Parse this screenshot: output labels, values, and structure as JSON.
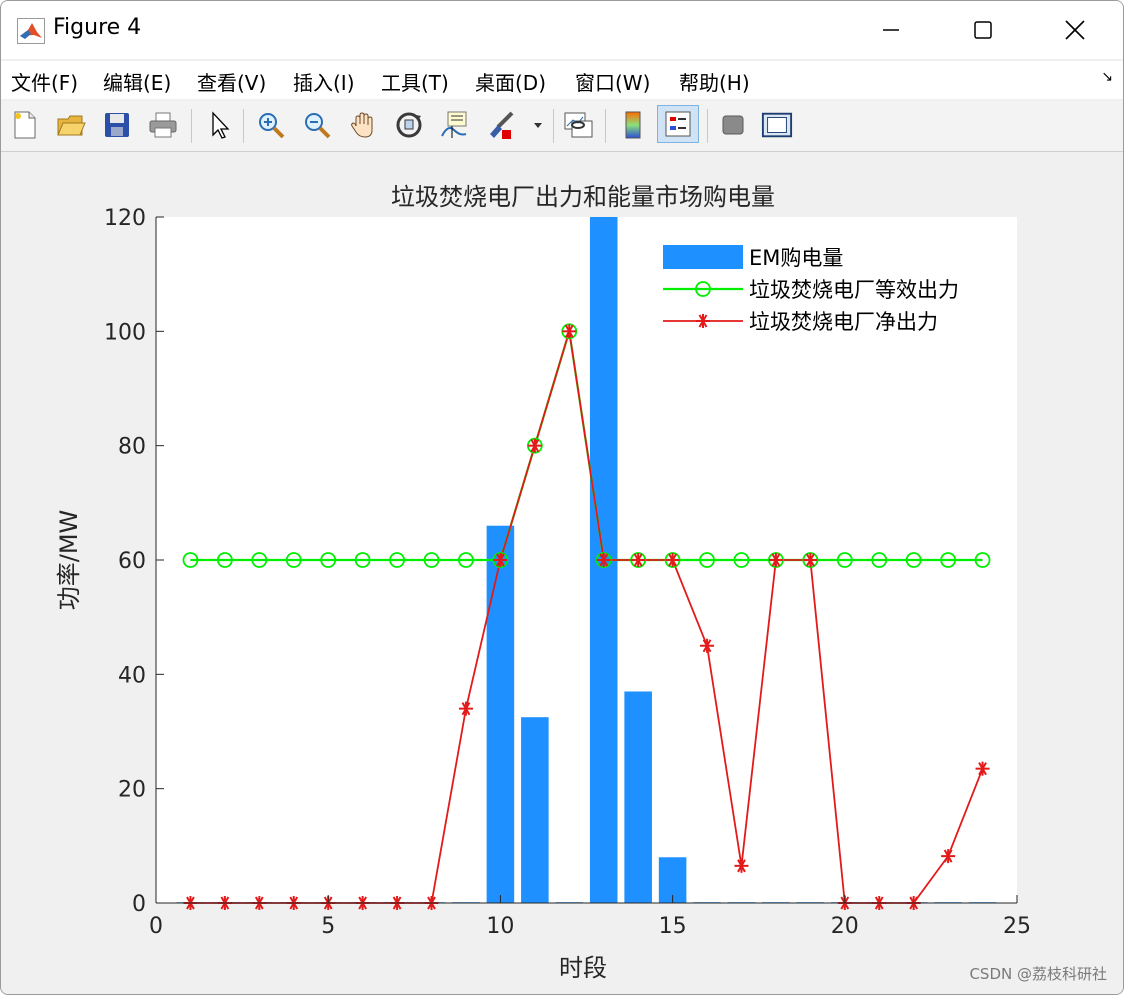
{
  "window": {
    "title": "Figure 4",
    "minimize_icon": "minimize-icon",
    "maximize_icon": "maximize-icon",
    "close_icon": "close-icon"
  },
  "menu": [
    {
      "label": "文件(F)"
    },
    {
      "label": "编辑(E)"
    },
    {
      "label": "查看(V)"
    },
    {
      "label": "插入(I)"
    },
    {
      "label": "工具(T)"
    },
    {
      "label": "桌面(D)"
    },
    {
      "label": "窗口(W)"
    },
    {
      "label": "帮助(H)"
    }
  ],
  "toolbar": {
    "icons": [
      "new-figure-icon",
      "open-file-icon",
      "save-icon",
      "print-icon",
      "pointer-icon",
      "zoom-in-icon",
      "zoom-out-icon",
      "pan-icon",
      "rotate-3d-icon",
      "data-cursor-icon",
      "brush-icon",
      "link-plot-icon",
      "colorbar-icon",
      "legend-icon",
      "hide-plot-tools-icon",
      "show-plot-tools-icon"
    ],
    "active": "legend-icon"
  },
  "watermark": "CSDN @荔枝科研社",
  "colors": {
    "bar": "#1e90ff",
    "equiv_line": "#00ee00",
    "net_line": "#e31a1a",
    "axis_bg": "#ffffff",
    "figure_bg": "#f0f0f0"
  },
  "chart_data": {
    "type": "bar+line",
    "title": "垃圾焚烧电厂出力和能量市场购电量",
    "xlabel": "时段",
    "ylabel": "功率/MW",
    "xlim": [
      0,
      25
    ],
    "ylim": [
      0,
      120
    ],
    "xticks": [
      0,
      5,
      10,
      15,
      20,
      25
    ],
    "yticks": [
      0,
      20,
      40,
      60,
      80,
      100,
      120
    ],
    "grid": false,
    "legend_position": "top-right",
    "x": [
      1,
      2,
      3,
      4,
      5,
      6,
      7,
      8,
      9,
      10,
      11,
      12,
      13,
      14,
      15,
      16,
      17,
      18,
      19,
      20,
      21,
      22,
      23,
      24
    ],
    "series": [
      {
        "name": "EM购电量",
        "kind": "bar",
        "values": [
          0,
          0,
          0,
          0,
          0,
          0,
          0,
          0,
          0,
          66,
          32.5,
          0,
          120,
          37,
          8,
          0,
          0,
          0,
          0,
          0,
          0,
          0,
          0,
          0
        ]
      },
      {
        "name": "垃圾焚烧电厂等效出力",
        "kind": "line",
        "marker": "circle",
        "values": [
          60,
          60,
          60,
          60,
          60,
          60,
          60,
          60,
          60,
          60,
          80,
          100,
          60,
          60,
          60,
          60,
          60,
          60,
          60,
          60,
          60,
          60,
          60,
          60
        ]
      },
      {
        "name": "垃圾焚烧电厂净出力",
        "kind": "line",
        "marker": "asterisk",
        "values": [
          0,
          0,
          0,
          0,
          0,
          0,
          0,
          0,
          34,
          60,
          80,
          100,
          60,
          60,
          60,
          45,
          6.5,
          60,
          60,
          0,
          0,
          0,
          8.2,
          23.5
        ]
      }
    ]
  }
}
